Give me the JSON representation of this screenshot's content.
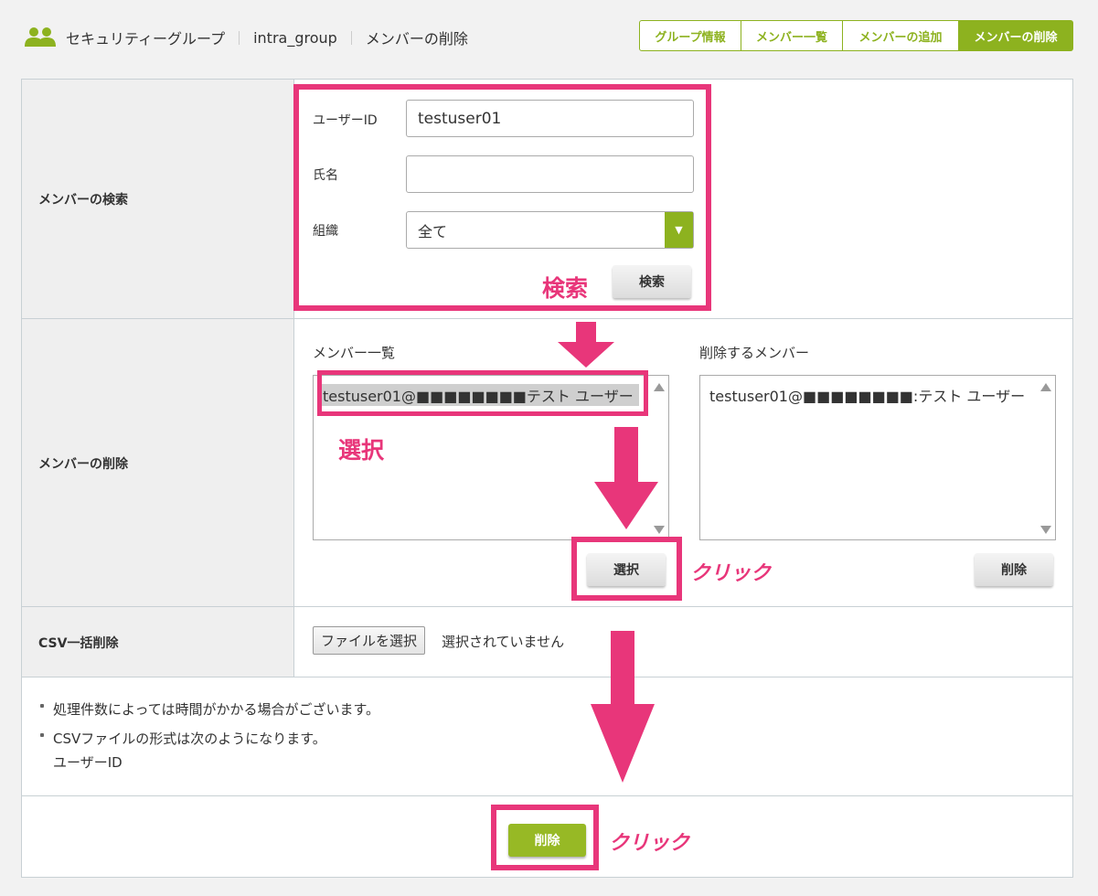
{
  "header": {
    "breadcrumb": [
      "セキュリティーグループ",
      "intra_group",
      "メンバーの削除"
    ],
    "tabs": [
      {
        "label": "グループ情報",
        "active": false
      },
      {
        "label": "メンバー一覧",
        "active": false
      },
      {
        "label": "メンバーの追加",
        "active": false
      },
      {
        "label": "メンバーの削除",
        "active": true
      }
    ]
  },
  "search": {
    "row_label": "メンバーの検索",
    "user_id_label": "ユーザーID",
    "user_id_value": "testuser01",
    "name_label": "氏名",
    "name_value": "",
    "org_label": "組織",
    "org_selected": "全て",
    "search_button": "検索"
  },
  "delete": {
    "row_label": "メンバーの削除",
    "member_list_label": "メンバー一覧",
    "member_list_items": [
      "testuser01@■■■■■■■■テスト ユーザー"
    ],
    "delete_list_label": "削除するメンバー",
    "delete_list_items": [
      "testuser01@■■■■■■■■:テスト ユーザー"
    ],
    "select_button": "選択",
    "remove_button": "削除"
  },
  "csv": {
    "row_label": "CSV一括削除",
    "file_button": "ファイルを選択",
    "file_status": "選択されていません"
  },
  "notes": {
    "line1": "処理件数によっては時間がかかる場合がございます。",
    "line2": "CSVファイルの形式は次のようになります。",
    "line3": "ユーザーID"
  },
  "submit_button": "削除",
  "annotations": {
    "search": "検索",
    "select": "選択",
    "click1": "クリック",
    "click2": "クリック",
    "color": "#e8367a"
  },
  "colors": {
    "accent": "#8db21f",
    "annotation": "#e8367a"
  }
}
